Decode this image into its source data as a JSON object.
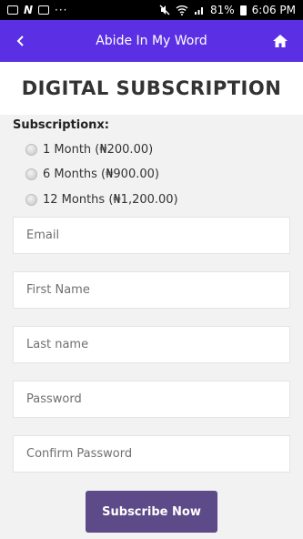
{
  "status_bar": {
    "battery": "81%",
    "time": "6:06 PM",
    "left_icons": [
      "image-icon",
      "n-icon",
      "flipboard-icon",
      "more-icon"
    ],
    "right_icons": [
      "mute-icon",
      "wifi-icon",
      "signal-icon",
      "battery-icon"
    ]
  },
  "app_bar": {
    "title": "Abide In My Word",
    "background": "#5b2fe3",
    "back_icon": "back-chevron-icon",
    "home_icon": "home-icon"
  },
  "heading": "DIGITAL SUBSCRIPTION",
  "subscription": {
    "label": "Subscriptionx:",
    "options": [
      {
        "label": "1 Month (₦200.00)",
        "selected": false
      },
      {
        "label": "6 Months (₦900.00)",
        "selected": false
      },
      {
        "label": "12 Months (₦1,200.00)",
        "selected": false
      }
    ]
  },
  "form": {
    "email_placeholder": "Email",
    "first_name_placeholder": "First Name",
    "last_name_placeholder": "Last name",
    "password_placeholder": "Password",
    "confirm_password_placeholder": "Confirm Password",
    "submit_label": "Subscribe Now",
    "submit_color": "#5d4a88"
  }
}
